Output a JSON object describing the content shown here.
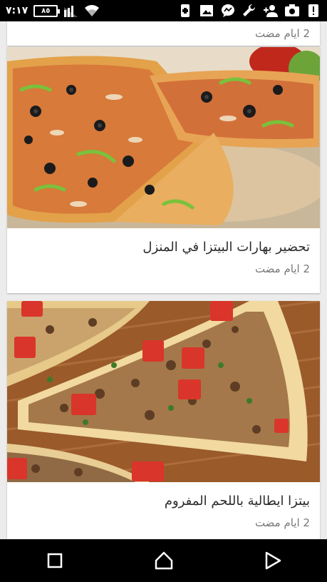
{
  "status": {
    "time": "٧:١٧",
    "battery": "٨٥",
    "icons": [
      "signal-icon",
      "wifi-icon",
      "add-icon",
      "image-icon",
      "messenger-icon",
      "wrench-icon",
      "add-user-icon",
      "camera-icon",
      "alert-icon"
    ]
  },
  "articles": [
    {
      "title": "",
      "meta": "2 ايام مضت"
    },
    {
      "title": "تحضير بهارات البيتزا في المنزل",
      "meta": "2 ايام مضت"
    },
    {
      "title": "بيتزا ايطالية باللحم المفروم",
      "meta": "2 ايام مضت"
    }
  ],
  "nav": {
    "icons": [
      "recent-apps-icon",
      "home-icon",
      "back-icon"
    ]
  },
  "colors": {
    "background": "#ececec",
    "card": "#ffffff",
    "bars": "#000000",
    "title": "#2b2b2b",
    "meta": "#777777"
  }
}
